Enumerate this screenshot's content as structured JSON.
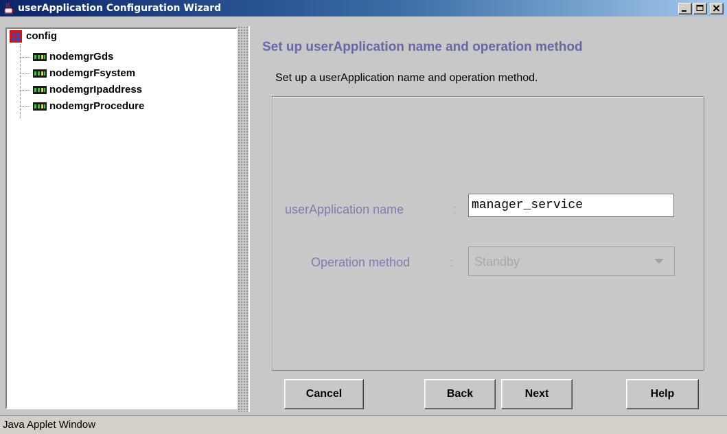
{
  "window": {
    "title": "userApplication Configuration Wizard",
    "icon": "java-cup-icon",
    "controls": [
      "minimize-icon",
      "maximize-icon",
      "close-icon"
    ]
  },
  "tree": {
    "root": {
      "label": "config",
      "icon": "config-folder-icon"
    },
    "items": [
      {
        "label": "nodemgrGds",
        "icon": "resource-chip-icon"
      },
      {
        "label": "nodemgrFsystem",
        "icon": "resource-chip-icon"
      },
      {
        "label": "nodemgrIpaddress",
        "icon": "resource-chip-icon"
      },
      {
        "label": "nodemgrProcedure",
        "icon": "resource-chip-icon"
      }
    ]
  },
  "main": {
    "heading": "Set up userApplication name and operation method",
    "description": "Set up a userApplication name and operation method.",
    "form": {
      "name_label": "userApplication name",
      "name_colon": ":",
      "name_value": "manager_service",
      "method_label": "Operation method",
      "method_colon": ":",
      "method_value": "Standby"
    }
  },
  "buttons": {
    "cancel": "Cancel",
    "back": "Back",
    "next": "Next",
    "help": "Help"
  },
  "status": {
    "text": "Java Applet Window"
  },
  "colors": {
    "titlebar_start": "#0a246a",
    "titlebar_end": "#a6caf0",
    "heading": "#6668a4",
    "form_label": "#7c7eb2",
    "window_bg": "#c8c8c8"
  }
}
